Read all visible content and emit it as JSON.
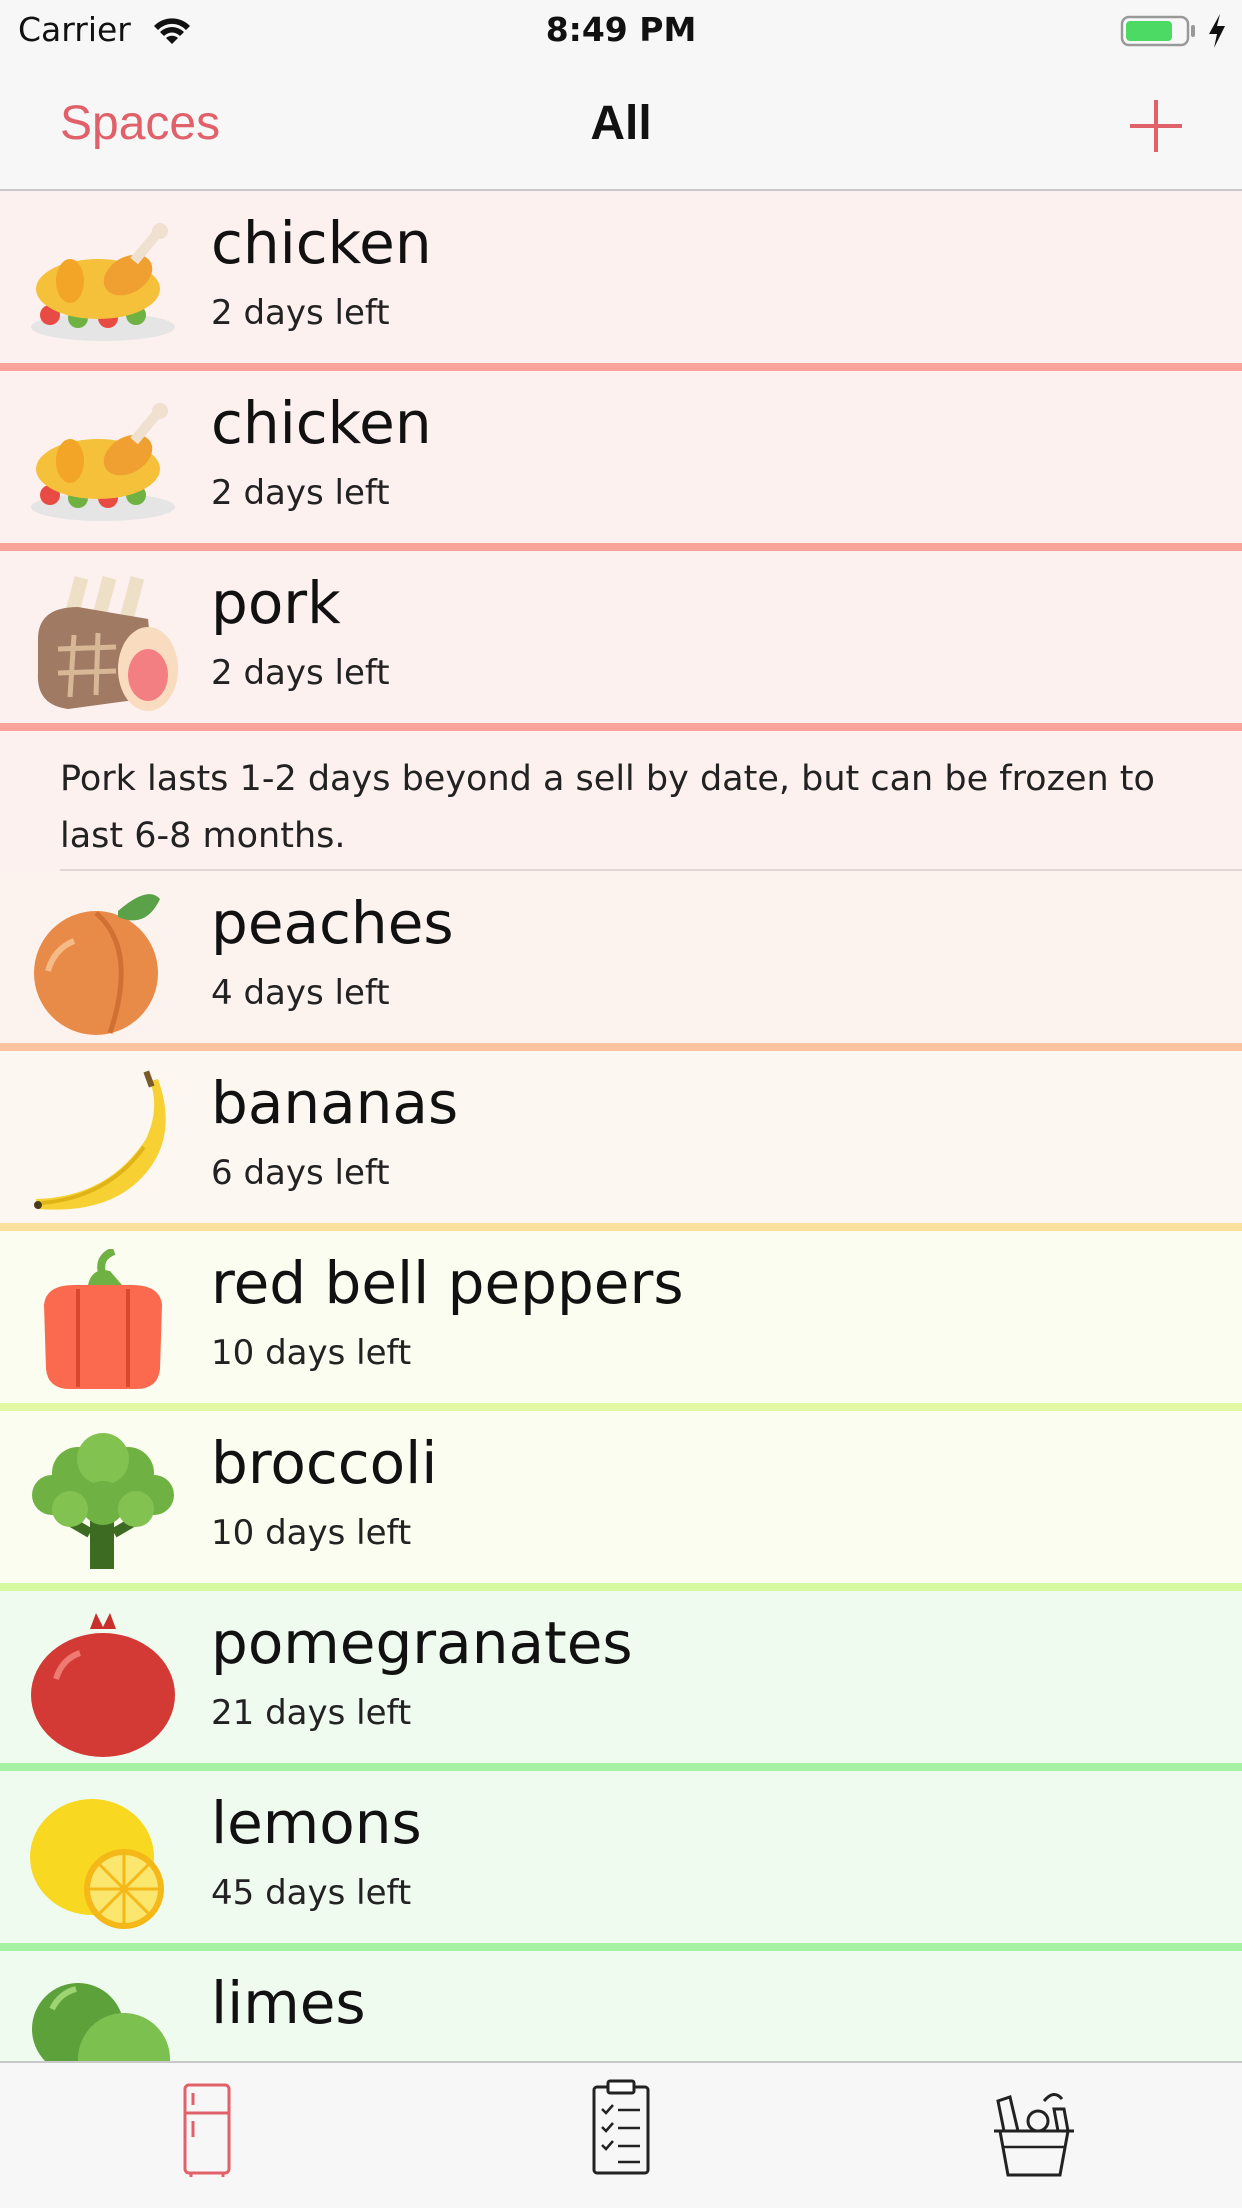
{
  "status_bar": {
    "carrier": "Carrier",
    "time": "8:49 PM",
    "icons": [
      "wifi-icon",
      "battery-icon",
      "charging-icon"
    ]
  },
  "nav": {
    "left_label": "Spaces",
    "title": "All",
    "right_icon": "plus-icon",
    "accent_color": "#e0616a"
  },
  "items": [
    {
      "name": "chicken",
      "days": "2 days left",
      "icon": "roast-chicken-icon",
      "bg": "#fdf1f0",
      "sep": "#f8a49a"
    },
    {
      "name": "chicken",
      "days": "2 days left",
      "icon": "roast-chicken-icon",
      "bg": "#fdf1f0",
      "sep": "#f8a49a"
    },
    {
      "name": "pork",
      "days": "2 days left",
      "icon": "pork-roast-icon",
      "bg": "#fdf1f0",
      "sep": "#f8a49a"
    },
    {
      "name": "peaches",
      "days": "4 days left",
      "icon": "peach-icon",
      "bg": "#fdf3ee",
      "sep": "#fbc49e"
    },
    {
      "name": "bananas",
      "days": "6 days left",
      "icon": "banana-icon",
      "bg": "#fdf7f1",
      "sep": "#fbe09e"
    },
    {
      "name": "red bell peppers",
      "days": "10 days left",
      "icon": "bell-pepper-icon",
      "bg": "#fafdef",
      "sep": "#e2f8a2"
    },
    {
      "name": "broccoli",
      "days": "10 days left",
      "icon": "broccoli-icon",
      "bg": "#fafdef",
      "sep": "#d6f8a0"
    },
    {
      "name": "pomegranates",
      "days": "21 days left",
      "icon": "pomegranate-icon",
      "bg": "#f0fbf0",
      "sep": "#a6f2a4"
    },
    {
      "name": "lemons",
      "days": "45 days left",
      "icon": "lemon-icon",
      "bg": "#f0fbf0",
      "sep": "#a6f2a4"
    },
    {
      "name": "limes",
      "days": "",
      "icon": "lime-icon",
      "bg": "#f0fbf0",
      "sep": "#a6f2a4"
    }
  ],
  "note": {
    "text": "Pork lasts 1-2 days beyond a sell by date, but can be frozen to last 6-8 months.",
    "bg": "#fdf1f0"
  },
  "tabs": [
    {
      "name": "fridge",
      "icon": "fridge-icon",
      "active": true
    },
    {
      "name": "checklist",
      "icon": "clipboard-icon",
      "active": false
    },
    {
      "name": "basket",
      "icon": "basket-icon",
      "active": false
    }
  ]
}
